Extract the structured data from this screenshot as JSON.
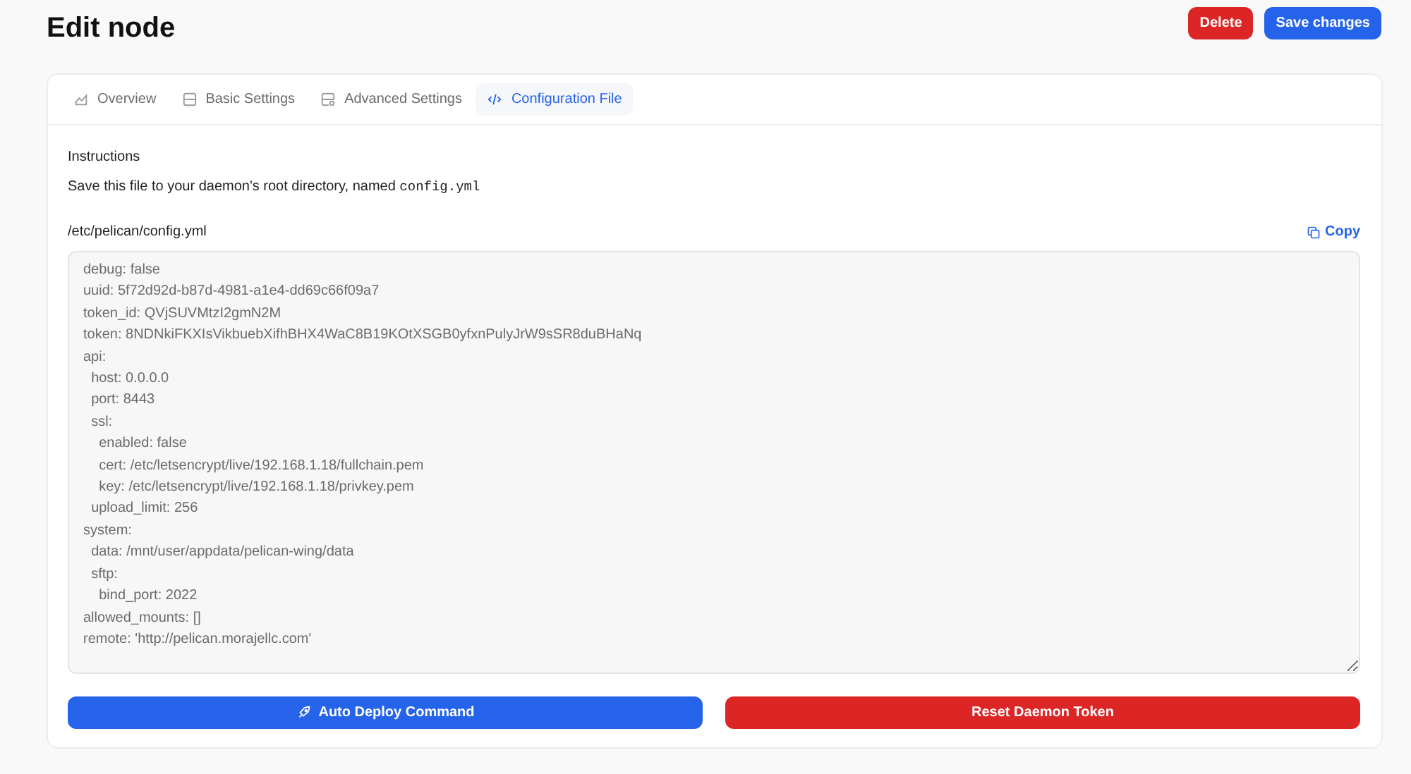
{
  "page": {
    "title": "Edit node"
  },
  "header_buttons": [
    {
      "label": "Delete",
      "kind": "danger"
    },
    {
      "label": "Save changes",
      "kind": "primary"
    }
  ],
  "tabs": [
    {
      "label": "Overview",
      "selected": false
    },
    {
      "label": "Basic Settings",
      "selected": false
    },
    {
      "label": "Advanced Settings",
      "selected": false
    },
    {
      "label": "Configuration File",
      "selected": true
    }
  ],
  "instructions": {
    "heading": "Instructions",
    "text": "Save this file to your daemon's root directory, named",
    "filename": "config.yml"
  },
  "config_file": {
    "path": "/etc/pelican/config.yml",
    "copy_label": "Copy",
    "lines": [
      "debug: false",
      "uuid: 5f72d92d-b87d-4981-a1e4-dd69c66f09a7",
      "token_id: QVjSUVMtzI2gmN2M",
      "token: 8NDNkiFKXIsVikbuebXifhBHX4WaC8B19KOtXSGB0yfxnPulyJrW9sSR8duBHaNq",
      "api:",
      "  host: 0.0.0.0",
      "  port: 8443",
      "  ssl:",
      "    enabled: false",
      "    cert: /etc/letsencrypt/live/192.168.1.18/fullchain.pem",
      "    key: /etc/letsencrypt/live/192.168.1.18/privkey.pem",
      "  upload_limit: 256",
      "system:",
      "  data: /mnt/user/appdata/pelican-wing/data",
      "  sftp:",
      "    bind_port: 2022",
      "allowed_mounts: []",
      "remote: 'http://pelican.morajellc.com'"
    ]
  },
  "actions": [
    {
      "label": "Auto Deploy Command",
      "kind": "primary"
    },
    {
      "label": "Reset Daemon Token",
      "kind": "danger"
    }
  ]
}
